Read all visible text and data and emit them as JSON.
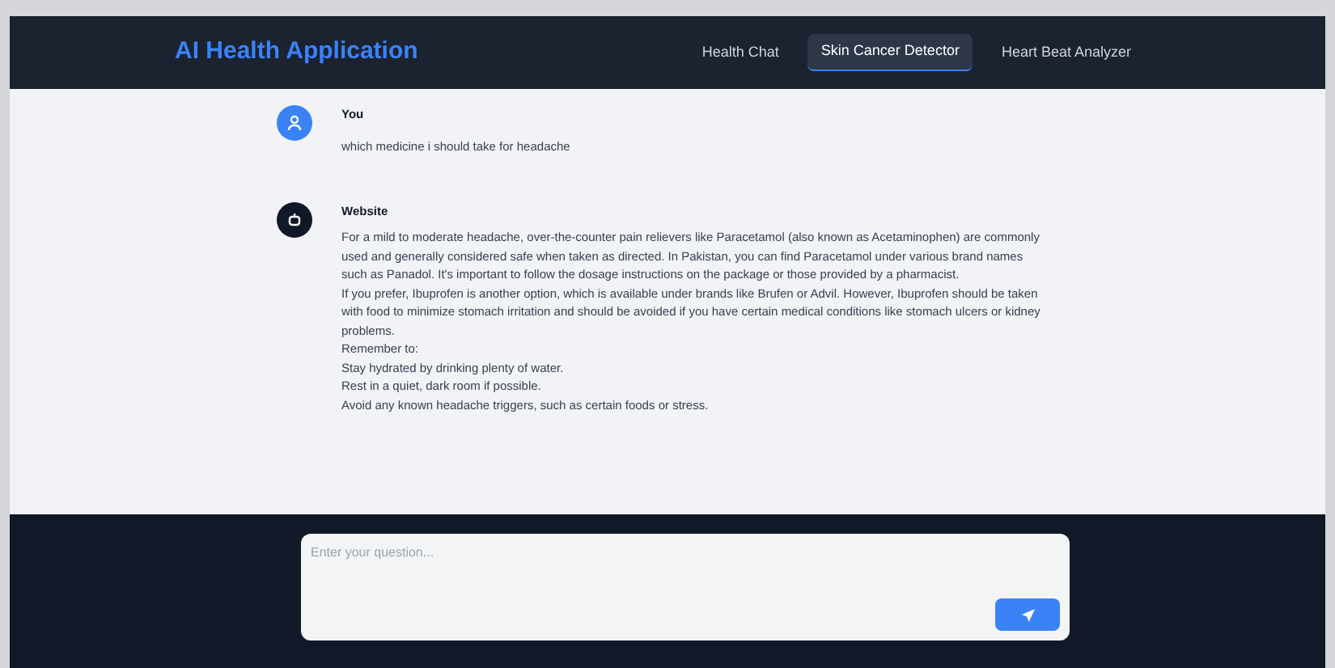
{
  "header": {
    "title": "AI Health Application"
  },
  "tabs": [
    {
      "label": "Health Chat",
      "selected": false
    },
    {
      "label": "Skin Cancer Detector",
      "selected": true
    },
    {
      "label": "Heart Beat Analyzer",
      "selected": false
    }
  ],
  "messages": [
    {
      "kind": "user",
      "sender": "You",
      "paragraphs": [
        "which medicine i should take for headache"
      ]
    },
    {
      "kind": "bot",
      "sender": "Website",
      "paragraphs": [
        "For a mild to moderate headache, over-the-counter pain relievers like Paracetamol (also known as Acetaminophen) are commonly used and generally considered safe when taken as directed. In Pakistan, you can find Paracetamol under various brand names such as Panadol. It's important to follow the dosage instructions on the package or those provided by a pharmacist.",
        "If you prefer, Ibuprofen is another option, which is available under brands like Brufen or Advil. However, Ibuprofen should be taken with food to minimize stomach irritation and should be avoided if you have certain medical conditions like stomach ulcers or kidney problems.",
        "Remember to:",
        "Stay hydrated by drinking plenty of water.",
        "Rest in a quiet, dark room if possible.",
        "Avoid any known headache triggers, such as certain foods or stress."
      ]
    }
  ],
  "composer": {
    "placeholder": "Enter your question..."
  }
}
